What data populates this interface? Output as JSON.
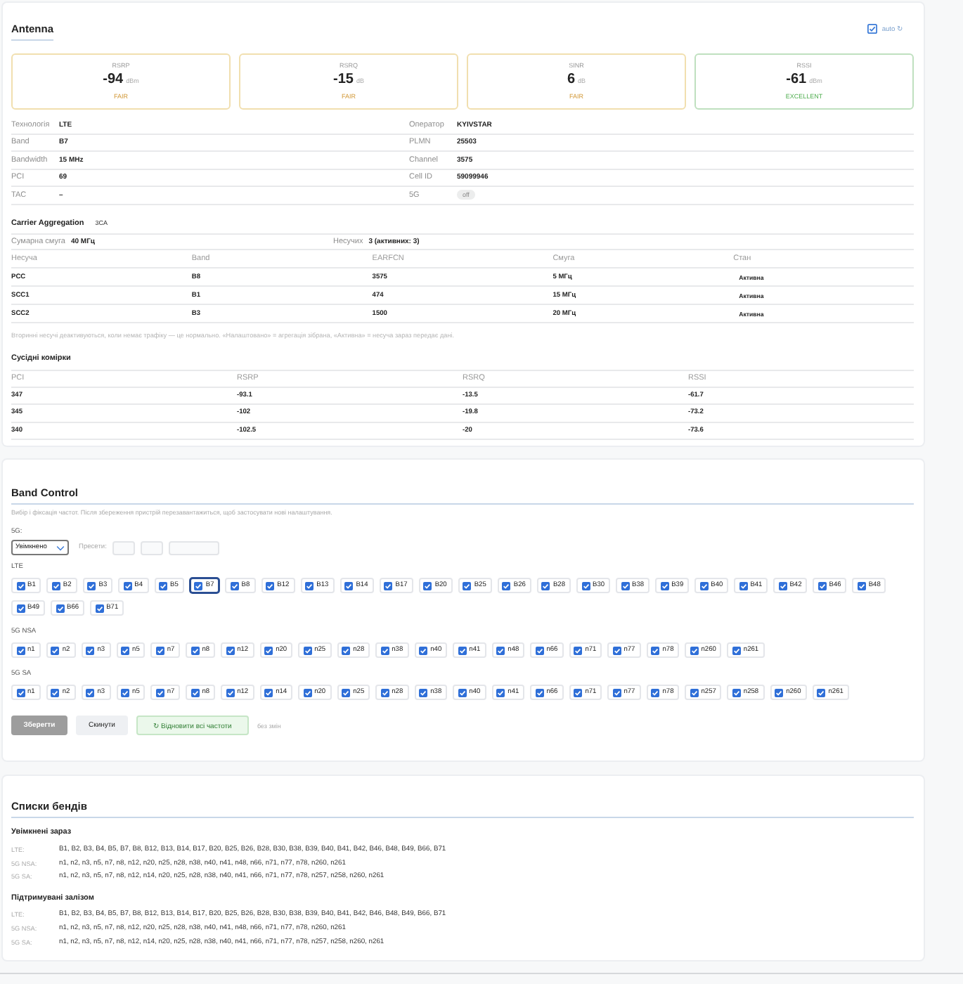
{
  "antenna": {
    "title": "Antenna",
    "auto": {
      "label": "auto ↻",
      "checked": true
    },
    "metrics": [
      {
        "label": "RSRP",
        "value": "-94",
        "unit": "dBm",
        "status": "FAIR",
        "kind": "fair"
      },
      {
        "label": "RSRQ",
        "value": "-15",
        "unit": "dB",
        "status": "FAIR",
        "kind": "fair"
      },
      {
        "label": "SINR",
        "value": "6",
        "unit": "dB",
        "status": "FAIR",
        "kind": "fair"
      },
      {
        "label": "RSSI",
        "value": "-61",
        "unit": "dBm",
        "status": "EXCELLENT",
        "kind": "excellent"
      }
    ],
    "info_rows": [
      [
        {
          "label": "Технологія",
          "value": "LTE",
          "kind": "text"
        },
        {
          "label": "Оператор",
          "value": "KYIVSTAR",
          "kind": "text"
        }
      ],
      [
        {
          "label": "Band",
          "value": "B7",
          "kind": "text"
        },
        {
          "label": "PLMN",
          "value": "25503",
          "kind": "text"
        }
      ],
      [
        {
          "label": "Bandwidth",
          "value": "15 MHz",
          "kind": "text"
        },
        {
          "label": "Channel",
          "value": "3575",
          "kind": "text"
        }
      ],
      [
        {
          "label": "PCI",
          "value": "69",
          "kind": "text"
        },
        {
          "label": "Cell ID",
          "value": "59099946",
          "kind": "text"
        }
      ],
      [
        {
          "label": "TAC",
          "value": "–",
          "kind": "text"
        },
        {
          "label": "5G",
          "value": "off",
          "kind": "badge"
        }
      ]
    ],
    "carrier_aggregation": {
      "title": "Carrier Aggregation",
      "badge": "3CA",
      "summary": [
        {
          "label": "Сумарна смуга",
          "value": "40 МГц"
        },
        {
          "label": "Несучих",
          "value": "3 (активних: 3)"
        }
      ],
      "columns": [
        "Несуча",
        "Band",
        "EARFCN",
        "Смуга",
        "Стан"
      ],
      "rows": [
        [
          "PCC",
          "B8",
          "3575",
          "5 МГц",
          "Активна"
        ],
        [
          "SCC1",
          "B1",
          "474",
          "15 МГц",
          "Активна"
        ],
        [
          "SCC2",
          "B3",
          "1500",
          "20 МГц",
          "Активна"
        ]
      ]
    },
    "note": "Вторинні несучі деактивуються, коли немає трафіку — це нормально. «Налаштовано» = агрегація зібрана, «Активна» = несуча зараз передає дані.",
    "neighbors": {
      "title": "Сусідні комірки",
      "columns": [
        "PCI",
        "RSRP",
        "RSRQ",
        "RSSI"
      ],
      "rows": [
        [
          "347",
          "-93.1",
          "-13.5",
          "-61.7"
        ],
        [
          "345",
          "-102",
          "-19.8",
          "-73.2"
        ],
        [
          "340",
          "-102.5",
          "-20",
          "-73.6"
        ]
      ]
    }
  },
  "band_control": {
    "title": "Band Control",
    "hint": "Вибір і фіксація частот. Після збереження пристрій перезавантажиться, щоб застосувати нові налаштування.",
    "mode": {
      "label": "5G:",
      "value": "Увімкнено"
    },
    "presets": {
      "label": "Пресети:",
      "buttons": [
        {
          "kind": "narrow"
        },
        {
          "kind": "narrow"
        },
        {
          "kind": "wide"
        }
      ]
    },
    "groups": [
      {
        "label": "LTE",
        "bands": [
          {
            "name": "B1",
            "checked": true,
            "focused": false
          },
          {
            "name": "B2",
            "checked": true,
            "focused": false
          },
          {
            "name": "B3",
            "checked": true,
            "focused": false
          },
          {
            "name": "B4",
            "checked": true,
            "focused": false
          },
          {
            "name": "B5",
            "checked": true,
            "focused": false
          },
          {
            "name": "B7",
            "checked": true,
            "focused": true
          },
          {
            "name": "B8",
            "checked": true,
            "focused": false
          },
          {
            "name": "B12",
            "checked": true,
            "focused": false
          },
          {
            "name": "B13",
            "checked": true,
            "focused": false
          },
          {
            "name": "B14",
            "checked": true,
            "focused": false
          },
          {
            "name": "B17",
            "checked": true,
            "focused": false
          },
          {
            "name": "B20",
            "checked": true,
            "focused": false
          },
          {
            "name": "B25",
            "checked": true,
            "focused": false
          },
          {
            "name": "B26",
            "checked": true,
            "focused": false
          },
          {
            "name": "B28",
            "checked": true,
            "focused": false
          },
          {
            "name": "B30",
            "checked": true,
            "focused": false
          },
          {
            "name": "B38",
            "checked": true,
            "focused": false
          },
          {
            "name": "B39",
            "checked": true,
            "focused": false
          },
          {
            "name": "B40",
            "checked": true,
            "focused": false
          },
          {
            "name": "B41",
            "checked": true,
            "focused": false
          },
          {
            "name": "B42",
            "checked": true,
            "focused": false
          },
          {
            "name": "B46",
            "checked": true,
            "focused": false
          },
          {
            "name": "B48",
            "checked": true,
            "focused": false
          },
          {
            "name": "B49",
            "checked": true,
            "focused": false
          },
          {
            "name": "B66",
            "checked": true,
            "focused": false
          },
          {
            "name": "B71",
            "checked": true,
            "focused": false
          }
        ]
      },
      {
        "label": "5G NSA",
        "bands": [
          {
            "name": "n1",
            "checked": true,
            "focused": false
          },
          {
            "name": "n2",
            "checked": true,
            "focused": false
          },
          {
            "name": "n3",
            "checked": true,
            "focused": false
          },
          {
            "name": "n5",
            "checked": true,
            "focused": false
          },
          {
            "name": "n7",
            "checked": true,
            "focused": false
          },
          {
            "name": "n8",
            "checked": true,
            "focused": false
          },
          {
            "name": "n12",
            "checked": true,
            "focused": false
          },
          {
            "name": "n20",
            "checked": true,
            "focused": false
          },
          {
            "name": "n25",
            "checked": true,
            "focused": false
          },
          {
            "name": "n28",
            "checked": true,
            "focused": false
          },
          {
            "name": "n38",
            "checked": true,
            "focused": false
          },
          {
            "name": "n40",
            "checked": true,
            "focused": false
          },
          {
            "name": "n41",
            "checked": true,
            "focused": false
          },
          {
            "name": "n48",
            "checked": true,
            "focused": false
          },
          {
            "name": "n66",
            "checked": true,
            "focused": false
          },
          {
            "name": "n71",
            "checked": true,
            "focused": false
          },
          {
            "name": "n77",
            "checked": true,
            "focused": false
          },
          {
            "name": "n78",
            "checked": true,
            "focused": false
          },
          {
            "name": "n260",
            "checked": true,
            "focused": false
          },
          {
            "name": "n261",
            "checked": true,
            "focused": false
          }
        ]
      },
      {
        "label": "5G SA",
        "bands": [
          {
            "name": "n1",
            "checked": true,
            "focused": false
          },
          {
            "name": "n2",
            "checked": true,
            "focused": false
          },
          {
            "name": "n3",
            "checked": true,
            "focused": false
          },
          {
            "name": "n5",
            "checked": true,
            "focused": false
          },
          {
            "name": "n7",
            "checked": true,
            "focused": false
          },
          {
            "name": "n8",
            "checked": true,
            "focused": false
          },
          {
            "name": "n12",
            "checked": true,
            "focused": false
          },
          {
            "name": "n14",
            "checked": true,
            "focused": false
          },
          {
            "name": "n20",
            "checked": true,
            "focused": false
          },
          {
            "name": "n25",
            "checked": true,
            "focused": false
          },
          {
            "name": "n28",
            "checked": true,
            "focused": false
          },
          {
            "name": "n38",
            "checked": true,
            "focused": false
          },
          {
            "name": "n40",
            "checked": true,
            "focused": false
          },
          {
            "name": "n41",
            "checked": true,
            "focused": false
          },
          {
            "name": "n66",
            "checked": true,
            "focused": false
          },
          {
            "name": "n71",
            "checked": true,
            "focused": false
          },
          {
            "name": "n77",
            "checked": true,
            "focused": false
          },
          {
            "name": "n78",
            "checked": true,
            "focused": false
          },
          {
            "name": "n257",
            "checked": true,
            "focused": false
          },
          {
            "name": "n258",
            "checked": true,
            "focused": false
          },
          {
            "name": "n260",
            "checked": true,
            "focused": false
          },
          {
            "name": "n261",
            "checked": true,
            "focused": false
          }
        ]
      }
    ],
    "actions": [
      {
        "label": "Зберегти",
        "kind": "save",
        "disabled": true
      },
      {
        "label": "Скинути",
        "kind": "reset",
        "disabled": false
      },
      {
        "label": "↻ Відновити всі частоти",
        "kind": "restore",
        "disabled": false
      }
    ],
    "status": "без змін"
  },
  "band_lists": {
    "title": "Списки бендів",
    "sections": [
      {
        "title": "Увімкнені зараз",
        "rows": [
          {
            "label": "LTE:",
            "value": "B1, B2, B3, B4, B5, B7, B8, B12, B13, B14, B17, B20, B25, B26, B28, B30, B38, B39, B40, B41, B42, B46, B48, B49, B66, B71"
          },
          {
            "label": "5G NSA:",
            "value": "n1, n2, n3, n5, n7, n8, n12, n20, n25, n28, n38, n40, n41, n48, n66, n71, n77, n78, n260, n261"
          },
          {
            "label": "5G SA:",
            "value": "n1, n2, n3, n5, n7, n8, n12, n14, n20, n25, n28, n38, n40, n41, n66, n71, n77, n78, n257, n258, n260, n261"
          }
        ]
      },
      {
        "title": "Підтримувані залізом",
        "rows": [
          {
            "label": "LTE:",
            "value": "B1, B2, B3, B4, B5, B7, B8, B12, B13, B14, B17, B20, B25, B26, B28, B30, B38, B39, B40, B41, B42, B46, B48, B49, B66, B71"
          },
          {
            "label": "5G NSA:",
            "value": "n1, n2, n3, n5, n7, n8, n12, n20, n25, n28, n38, n40, n41, n48, n66, n71, n77, n78, n260, n261"
          },
          {
            "label": "5G SA:",
            "value": "n1, n2, n3, n5, n7, n8, n12, n14, n20, n25, n28, n38, n40, n41, n66, n71, n77, n78, n257, n258, n260, n261"
          }
        ]
      }
    ]
  }
}
